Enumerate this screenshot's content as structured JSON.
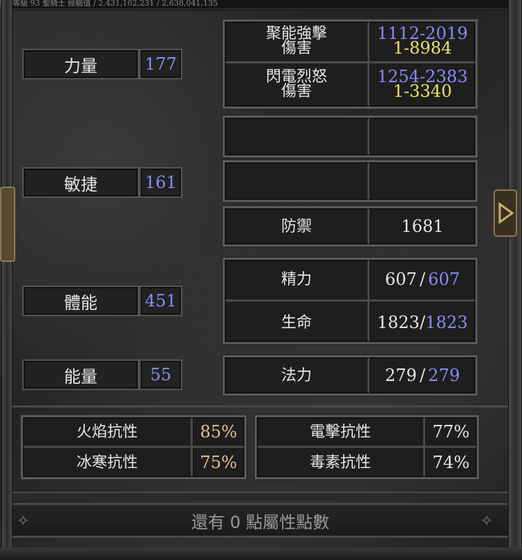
{
  "header": {
    "text": "等級 93 聖騎士   經驗值 / 2,431,102,231 / 2,638,041,135"
  },
  "attributes": [
    {
      "label": "力量",
      "value": "177"
    },
    {
      "label": "敏捷",
      "value": "161"
    },
    {
      "label": "體能",
      "value": "451"
    },
    {
      "label": "能量",
      "value": "55"
    }
  ],
  "skills": [
    {
      "name_line1": "聚能強擊",
      "name_line2": "傷害",
      "range": "1112-2019",
      "chance": "1-8984"
    },
    {
      "name_line1": "閃電烈怒",
      "name_line2": "傷害",
      "range": "1254-2383",
      "chance": "1-3340"
    }
  ],
  "defense": {
    "label": "防禦",
    "value": "1681"
  },
  "stamina": {
    "label": "精力",
    "current": "607",
    "max": "607",
    "slash": "/"
  },
  "life": {
    "label": "生命",
    "current": "1823",
    "max": "1823",
    "slash": "/"
  },
  "mana": {
    "label": "法力",
    "current": "279",
    "max": "279",
    "slash": "/"
  },
  "resistances": [
    {
      "label": "火焰抗性",
      "value": "85%"
    },
    {
      "label": "電擊抗性",
      "value": "77%"
    },
    {
      "label": "冰寒抗性",
      "value": "75%"
    },
    {
      "label": "毒素抗性",
      "value": "74%"
    }
  ],
  "footer": {
    "text": "還有 0 點屬性點數"
  },
  "colors": {
    "blue": "#8b8bf5",
    "yellow": "#e8e46a",
    "gold": "#d8c690",
    "text": "#e6e6e6"
  },
  "icons": {
    "right_arrow": "triangle-right-icon",
    "left_ornament": "ornament-icon"
  }
}
